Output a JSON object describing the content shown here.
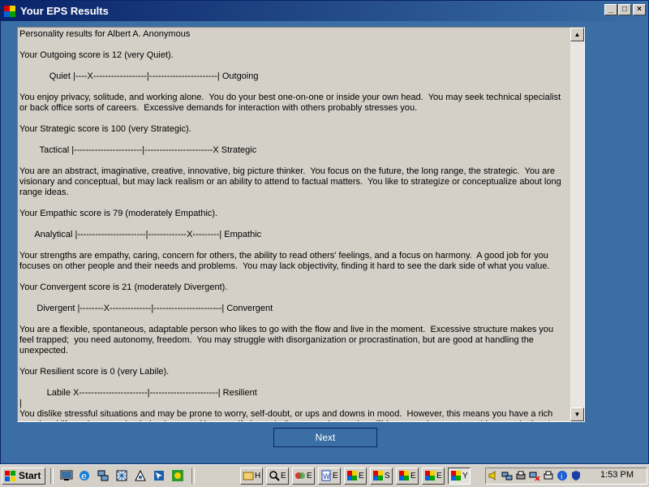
{
  "window": {
    "title": "Your EPS Results",
    "controls": {
      "minimize": "_",
      "maximize": "□",
      "close": "×"
    }
  },
  "results": {
    "text": "Personality results for Albert A. Anonymous\n\nYour Outgoing score is 12 (very Quiet).\n\n            Quiet |----X------------------|-----------------------| Outgoing\n\nYou enjoy privacy, solitude, and working alone.  You do your best one-on-one or inside your own head.  You may seek technical specialist or back office sorts of careers.  Excessive demands for interaction with others probably stresses you.\n\nYour Strategic score is 100 (very Strategic).\n\n        Tactical |-----------------------|-----------------------X Strategic\n\nYou are an abstract, imaginative, creative, innovative, big picture thinker.  You focus on the future, the long range, the strategic.  You are visionary and conceptual, but may lack realism or an ability to attend to factual matters.  You like to strategize or conceptualize about long range ideas.\n\nYour Empathic score is 79 (moderately Empathic).\n\n      Analytical |-----------------------|-------------X---------| Empathic\n\nYour strengths are empathy, caring, concern for others, the ability to read others' feelings, and a focus on harmony.  A good job for you focuses on other people and their needs and problems.  You may lack objectivity, finding it hard to see the dark side of what you value.\n\nYour Convergent score is 21 (moderately Divergent).\n\n       Divergent |--------X--------------|-----------------------| Convergent\n\nYou are a flexible, spontaneous, adaptable person who likes to go with the flow and live in the moment.  Excessive structure makes you feel trapped;  you need autonomy, freedom.  You may struggle with disorganization or procrastination, but are good at handling the unexpected.\n\nYour Resilient score is 0 (very Labile).\n\n           Labile X-----------------------|-----------------------| Resilient\n|\nYou dislike stressful situations and may be prone to worry, self-doubt, or ups and downs in mood.  However, this means you have a rich emotional life and are good at being honest with yourself about challenges and struggles.  This may make you empathic toward others' struggles."
  },
  "next_label": "Next",
  "taskbar": {
    "start_label": "Start",
    "tasks": [
      {
        "label": "H"
      },
      {
        "label": "E"
      },
      {
        "label": "E"
      },
      {
        "label": "E"
      },
      {
        "label": "E"
      },
      {
        "label": "S"
      },
      {
        "label": "E"
      },
      {
        "label": "E"
      },
      {
        "label": "Y"
      }
    ],
    "clock": "1:53 PM"
  },
  "colors": {
    "desktop": "#3a6ea5",
    "title_bar_start": "#0a246a",
    "panel": "#d4d0c8"
  }
}
